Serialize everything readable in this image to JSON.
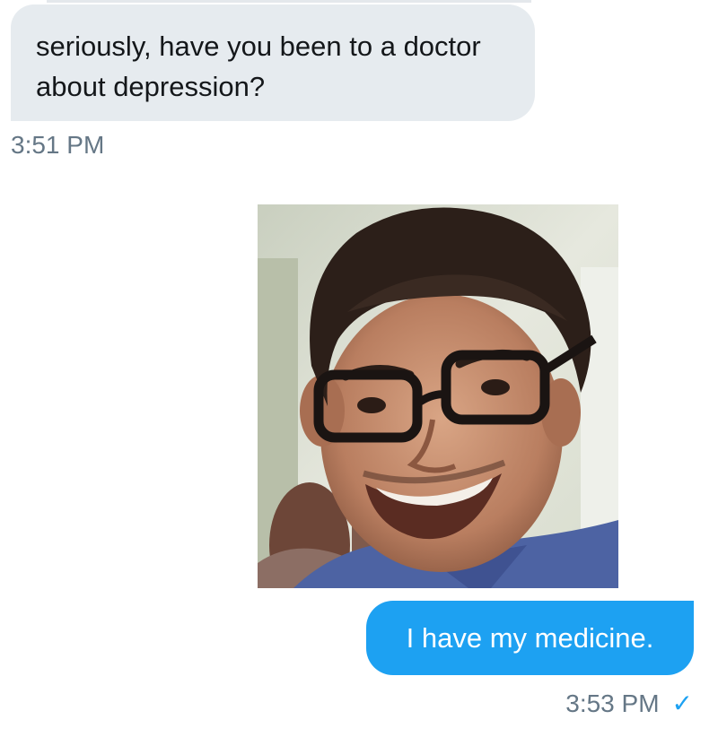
{
  "conversation": {
    "incoming_message": {
      "text": "seriously, have you been to a doctor about depression?",
      "timestamp": "3:51 PM"
    },
    "outgoing_image": {
      "description": "photo",
      "icon": "photo-of-smiling-man"
    },
    "outgoing_message": {
      "text": "I have my medicine.",
      "timestamp": "3:53 PM",
      "status_icon": "checkmark-icon",
      "status_glyph": "✓"
    }
  },
  "colors": {
    "incoming_bubble": "#e6ebef",
    "outgoing_bubble": "#1da1f2",
    "timestamp": "#657786",
    "accent": "#1da1f2"
  }
}
